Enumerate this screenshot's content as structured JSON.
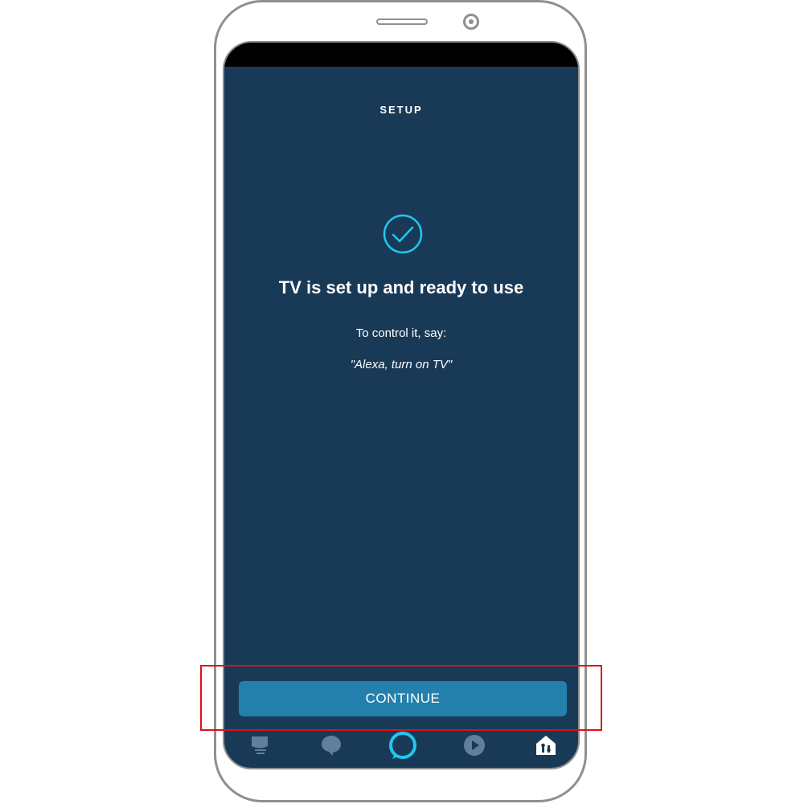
{
  "header": {
    "title": "SETUP"
  },
  "content": {
    "title": "TV is set up and ready to use",
    "instruction": "To control it, say:",
    "example_phrase": "\"Alexa, turn on TV\""
  },
  "actions": {
    "continue_label": "CONTINUE"
  },
  "tab_bar": {
    "items": [
      {
        "icon": "home-feed-icon"
      },
      {
        "icon": "communicate-icon"
      },
      {
        "icon": "alexa-icon"
      },
      {
        "icon": "play-icon"
      },
      {
        "icon": "devices-icon",
        "selected": true
      }
    ]
  },
  "colors": {
    "screen_bg": "#193a57",
    "accent": "#2380ad",
    "check": "#1ec8f0",
    "highlight": "#e0101a"
  }
}
